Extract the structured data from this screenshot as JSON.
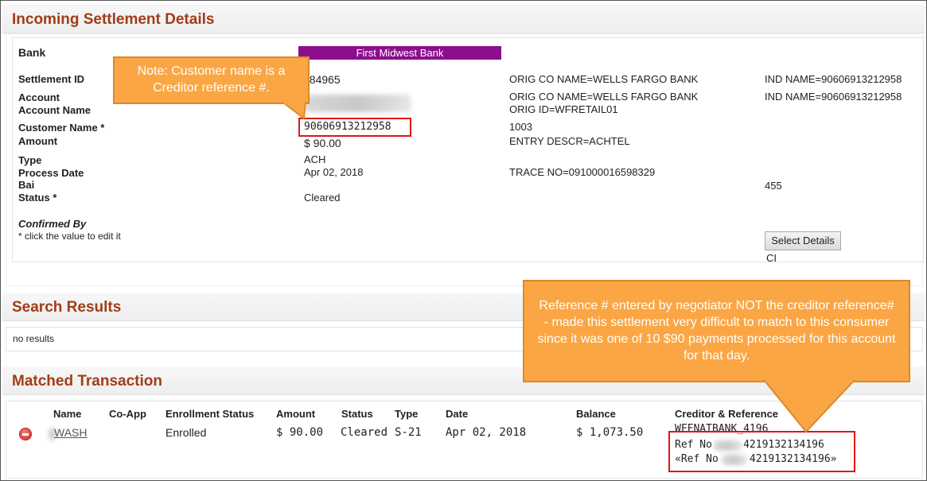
{
  "incoming": {
    "title": "Incoming Settlement Details",
    "bank_label": "Bank",
    "bank_value": "First Midwest Bank",
    "settlement_id_label": "Settlement ID",
    "settlement_id_value": "284965",
    "account_label": "Account",
    "account_name_label": "Account Name",
    "customer_name_label": "Customer Name *",
    "customer_name_value": "90606913212958",
    "amount_label": "Amount",
    "amount_value": "$ 90.00",
    "type_label": "Type",
    "type_value": "ACH",
    "process_date_label": "Process Date",
    "process_date_value": "Apr 02, 2018",
    "bai_label": "Bai",
    "status_label": "Status *",
    "status_value": "Cleared",
    "confirmed_by_label": "Confirmed By",
    "edit_hint": "* click the value to edit it",
    "orig_co_1": "ORIG CO NAME=WELLS FARGO BANK",
    "orig_co_2": "ORIG CO NAME=WELLS FARGO BANK",
    "orig_id": "ORIG ID=WFRETAIL01",
    "detail_1003": "1003",
    "entry_descr": "ENTRY DESCR=ACHTEL",
    "trace_no": "TRACE NO=091000016598329",
    "ind_name_1": "IND NAME=90606913212958",
    "ind_name_2": "IND NAME=90606913212958",
    "code_455": "455",
    "select_details_label": "Select Details",
    "ci_text": "CI"
  },
  "notes": {
    "customer_name_note": "Note: Customer name is a Creditor reference #.",
    "reference_note": "Reference # entered by negotiator NOT the creditor reference# - made this settlement very difficult to match to this consumer since it was one of 10 $90 payments processed for this account for that day."
  },
  "search": {
    "title": "Search Results",
    "empty_text": "no results"
  },
  "matched": {
    "title": "Matched Transaction",
    "columns": [
      "Name",
      "Co-App",
      "Enrollment Status",
      "Amount",
      "Status",
      "Type",
      "Date",
      "Balance",
      "Creditor & Reference"
    ],
    "row": {
      "name": "WASH",
      "enrollment_status": "Enrolled",
      "amount": "$ 90.00",
      "status": "Cleared",
      "type": "S-21",
      "date": "Apr 02, 2018",
      "balance": "$ 1,073.50",
      "creditor": "WFFNATBANK_4196",
      "ref_line_1": "Ref No     4219132134196",
      "ref_line_2": "«Ref No     4219132134196»"
    }
  },
  "colors": {
    "title": "#a23d17",
    "bank_bar": "#8b0e8c",
    "callout": "#fba644",
    "highlight_box": "#e21515"
  }
}
